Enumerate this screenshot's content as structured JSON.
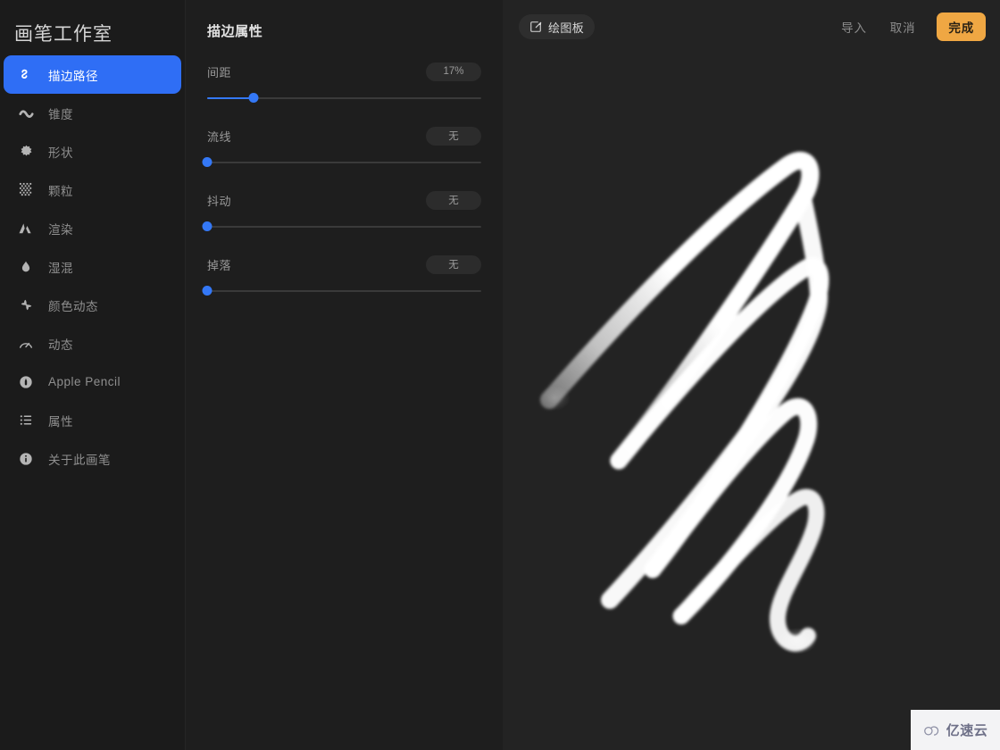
{
  "app": {
    "title": "画笔工作室",
    "accent_blue": "#2f6ef5",
    "accent_orange": "#efa743",
    "sidebar_bg": "#1b1b1b",
    "panel_bg": "#1e1e1e",
    "canvas_bg": "#232323"
  },
  "sidebar": {
    "items": [
      {
        "label": "描边路径",
        "icon": "stroke-path-icon",
        "active": true
      },
      {
        "label": "锥度",
        "icon": "taper-wave-icon",
        "active": false
      },
      {
        "label": "形状",
        "icon": "shape-blob-icon",
        "active": false
      },
      {
        "label": "颗粒",
        "icon": "grain-dots-icon",
        "active": false
      },
      {
        "label": "渲染",
        "icon": "render-mountain-icon",
        "active": false
      },
      {
        "label": "湿混",
        "icon": "wet-mix-droplet-icon",
        "active": false
      },
      {
        "label": "颜色动态",
        "icon": "color-dynamics-pinwheel-icon",
        "active": false
      },
      {
        "label": "动态",
        "icon": "dynamics-gauge-icon",
        "active": false
      },
      {
        "label": "Apple Pencil",
        "icon": "apple-pencil-icon",
        "active": false
      },
      {
        "label": "属性",
        "icon": "attributes-list-icon",
        "active": false
      },
      {
        "label": "关于此画笔",
        "icon": "info-circle-icon",
        "active": false
      }
    ]
  },
  "properties": {
    "title": "描边属性",
    "rows": [
      {
        "label": "间距",
        "value": "17%",
        "percent": 17
      },
      {
        "label": "流线",
        "value": "无",
        "percent": 0
      },
      {
        "label": "抖动",
        "value": "无",
        "percent": 0
      },
      {
        "label": "掉落",
        "value": "无",
        "percent": 0
      }
    ]
  },
  "toolbar": {
    "drawpad_label": "绘图板",
    "drawpad_icon": "compose-square-pencil-icon",
    "import_label": "导入",
    "cancel_label": "取消",
    "done_label": "完成"
  },
  "canvas": {
    "stroke_preview_name": "brush-stroke-preview",
    "stroke_color": "#ffffff"
  },
  "watermark": {
    "text": "亿速云",
    "icon": "cloud-icon"
  }
}
